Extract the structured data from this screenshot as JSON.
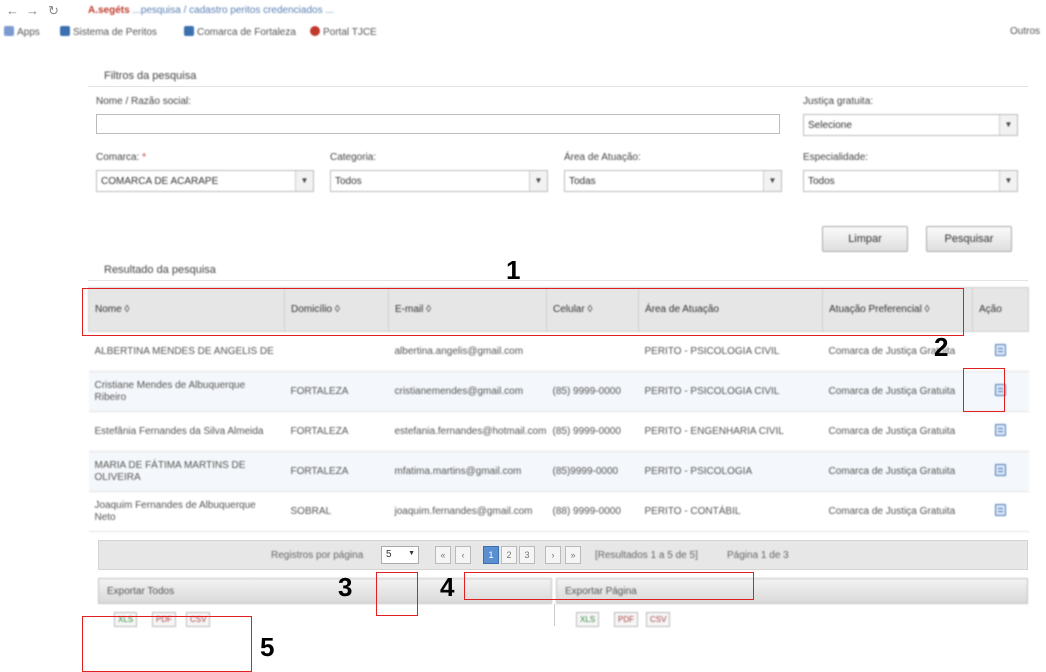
{
  "browser": {
    "address_host": "A.segéts",
    "address_rest": "...pesquisa / cadastro peritos credenciados ...",
    "bookmarks": [
      "Apps",
      "Sistema de Peritos",
      "Comarca de Fortaleza",
      "Portal TJCE"
    ],
    "bookmarks_right": "Outros"
  },
  "filters": {
    "title": "Filtros da pesquisa",
    "nome_label": "Nome / Razão social:",
    "nome_value": "",
    "justica_label": "Justiça gratuita:",
    "justica_value": "Selecione",
    "comarca_label": "Comarca:",
    "comarca_required": "*",
    "comarca_value": "COMARCA DE ACARAPE",
    "categoria_label": "Categoria:",
    "categoria_value": "Todos",
    "area_label": "Área de Atuação:",
    "area_value": "Todas",
    "especialidade_label": "Especialidade:",
    "especialidade_value": "Todos",
    "limpar": "Limpar",
    "pesquisar": "Pesquisar"
  },
  "results": {
    "title": "Resultado da pesquisa",
    "headers": [
      "Nome ◊",
      "Domicílio ◊",
      "E-mail ◊",
      "Celular ◊",
      "Área de Atuação",
      "Atuação Preferencial ◊",
      "Ação"
    ],
    "rows": [
      [
        "ALBERTINA MENDES DE ANGELIS DE",
        "",
        "albertina.angelis@gmail.com",
        "",
        "PERITO - PSICOLOGIA CIVIL",
        "Comarca de Justiça Gratuita",
        ""
      ],
      [
        "Cristiane Mendes de Albuquerque Ribeiro",
        "FORTALEZA",
        "cristianemendes@gmail.com",
        "(85) 9999-0000",
        "PERITO - PSICOLOGIA CIVIL",
        "Comarca de Justiça Gratuita",
        ""
      ],
      [
        "Estefânia Fernandes da Silva Almeida",
        "FORTALEZA",
        "estefania.fernandes@hotmail.com",
        "(85) 9999-0000",
        "PERITO - ENGENHARIA CIVIL",
        "Comarca de Justiça Gratuita",
        ""
      ],
      [
        "MARIA DE FÁTIMA MARTINS DE OLIVEIRA",
        "FORTALEZA",
        "mfatima.martins@gmail.com",
        "(85)9999-0000",
        "PERITO - PSICOLOGIA",
        "Comarca de Justiça Gratuita",
        ""
      ],
      [
        "Joaquim Fernandes de Albuquerque Neto",
        "SOBRAL",
        "joaquim.fernandes@gmail.com",
        "(88) 9999-0000",
        "PERITO - CONTÁBIL",
        "Comarca de Justiça Gratuita",
        ""
      ]
    ]
  },
  "paginator": {
    "label": "Registros por página",
    "per_page": "5",
    "pages": [
      "1",
      "2",
      "3"
    ],
    "summary": "[Resultados 1 a 5 de 5]",
    "page_info": "Página 1 de 3"
  },
  "export": {
    "all_title": "Exportar Todos",
    "page_title": "Exportar Página",
    "all_buttons": [
      "XLS",
      "PDF",
      "CSV"
    ],
    "page_buttons": [
      "XLS",
      "PDF",
      "CSV"
    ]
  },
  "callouts": [
    "1",
    "2",
    "3",
    "4",
    "5"
  ]
}
